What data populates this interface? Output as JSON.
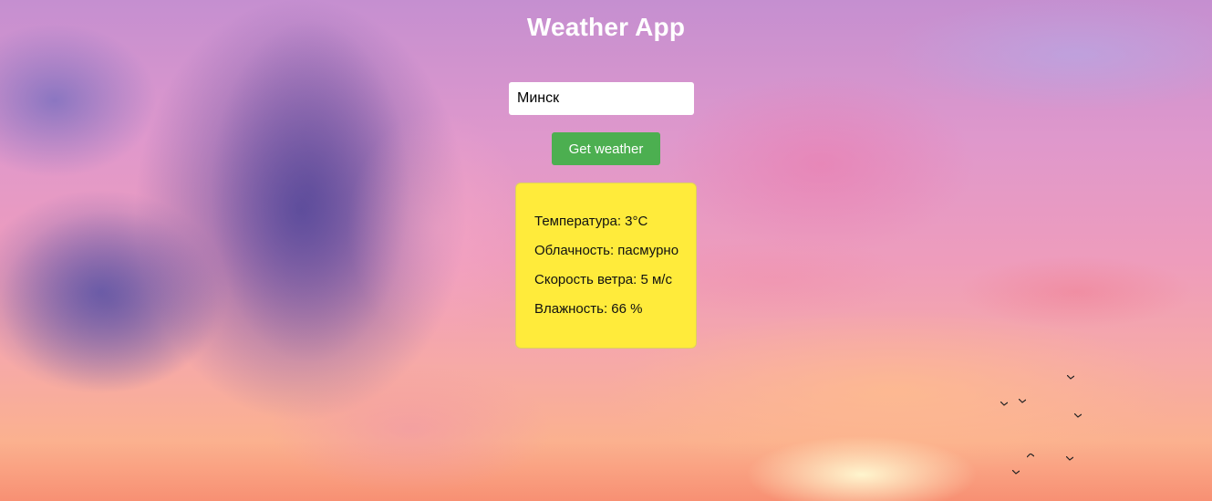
{
  "app": {
    "title": "Weather App"
  },
  "search": {
    "value": "Минск"
  },
  "actions": {
    "get_weather_label": "Get weather"
  },
  "weather": {
    "temperature": "Температура: 3°C",
    "cloudiness": "Облачность: пасмурно",
    "wind_speed": "Скорость ветра: 5 м/с",
    "humidity": "Влажность: 66 %"
  },
  "colors": {
    "button": "#4caf50",
    "card": "#ffeb3b",
    "title": "#ffffff"
  },
  "background": {
    "description_icon": "sunset-sky-with-clouds-and-birds"
  }
}
